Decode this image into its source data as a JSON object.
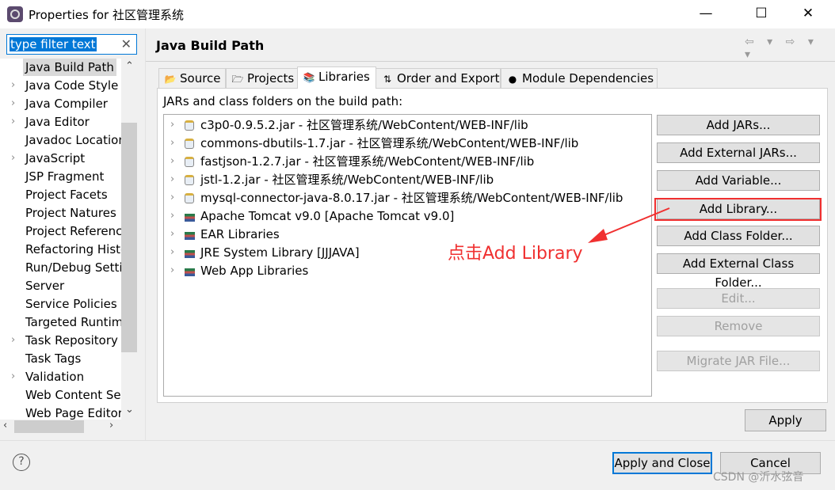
{
  "window": {
    "title": "Properties for 社区管理系统",
    "minimize": "—",
    "maximize": "☐",
    "close": "✕"
  },
  "filter": {
    "value": "type filter text",
    "clear": "✕"
  },
  "tree": {
    "items": [
      {
        "label": "Java Build Path",
        "expandable": false,
        "selected": true
      },
      {
        "label": "Java Code Style",
        "expandable": true
      },
      {
        "label": "Java Compiler",
        "expandable": true
      },
      {
        "label": "Java Editor",
        "expandable": true
      },
      {
        "label": "Javadoc Location",
        "expandable": false
      },
      {
        "label": "JavaScript",
        "expandable": true
      },
      {
        "label": "JSP Fragment",
        "expandable": false
      },
      {
        "label": "Project Facets",
        "expandable": false
      },
      {
        "label": "Project Natures",
        "expandable": false
      },
      {
        "label": "Project References",
        "expandable": false
      },
      {
        "label": "Refactoring History",
        "expandable": false
      },
      {
        "label": "Run/Debug Settings",
        "expandable": false
      },
      {
        "label": "Server",
        "expandable": false
      },
      {
        "label": "Service Policies",
        "expandable": false
      },
      {
        "label": "Targeted Runtimes",
        "expandable": false
      },
      {
        "label": "Task Repository",
        "expandable": true
      },
      {
        "label": "Task Tags",
        "expandable": false
      },
      {
        "label": "Validation",
        "expandable": true
      },
      {
        "label": "Web Content Settings",
        "expandable": false
      },
      {
        "label": "Web Page Editor",
        "expandable": false
      }
    ]
  },
  "header": {
    "title": "Java Build Path",
    "nav": "⇦ ▾ ⇨ ▾ ▾"
  },
  "tabs": [
    {
      "label": "Source",
      "icon": "source-folder-icon"
    },
    {
      "label": "Projects",
      "icon": "folder-open-icon"
    },
    {
      "label": "Libraries",
      "icon": "library-icon",
      "active": true
    },
    {
      "label": "Order and Export",
      "icon": "order-icon"
    },
    {
      "label": "Module Dependencies",
      "icon": "module-icon"
    }
  ],
  "libraries": {
    "label": "JARs and class folders on the build path:",
    "entries": [
      {
        "text": "c3p0-0.9.5.2.jar - 社区管理系统/WebContent/WEB-INF/lib",
        "icon": "jar"
      },
      {
        "text": "commons-dbutils-1.7.jar - 社区管理系统/WebContent/WEB-INF/lib",
        "icon": "jar"
      },
      {
        "text": "fastjson-1.2.7.jar - 社区管理系统/WebContent/WEB-INF/lib",
        "icon": "jar"
      },
      {
        "text": "jstl-1.2.jar - 社区管理系统/WebContent/WEB-INF/lib",
        "icon": "jar"
      },
      {
        "text": "mysql-connector-java-8.0.17.jar - 社区管理系统/WebContent/WEB-INF/lib",
        "icon": "jar"
      },
      {
        "text": "Apache Tomcat v9.0 [Apache Tomcat v9.0]",
        "icon": "lib"
      },
      {
        "text": "EAR Libraries",
        "icon": "lib"
      },
      {
        "text": "JRE System Library [JJJAVA]",
        "icon": "lib"
      },
      {
        "text": "Web App Libraries",
        "icon": "lib"
      }
    ],
    "buttons": {
      "add_jars": "Add JARs...",
      "add_external_jars": "Add External JARs...",
      "add_variable": "Add Variable...",
      "add_library": "Add Library...",
      "add_class_folder": "Add Class Folder...",
      "add_external_class_folder": "Add External Class Folder...",
      "edit": "Edit...",
      "remove": "Remove",
      "migrate": "Migrate JAR File..."
    }
  },
  "annotation": {
    "text": "点击Add Library",
    "color": "#f03030"
  },
  "footer": {
    "apply": "Apply",
    "apply_close": "Apply and Close",
    "cancel": "Cancel",
    "help": "?"
  },
  "watermark": "CSDN @沂水弦音"
}
